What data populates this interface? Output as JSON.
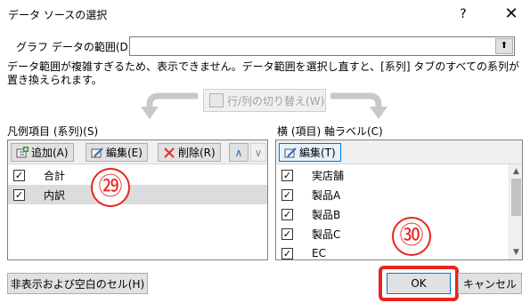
{
  "dialog": {
    "title": "データ ソースの選択",
    "help_label": "?",
    "close_label": "✕"
  },
  "range": {
    "label": "グラフ データの範囲(D):",
    "value": "",
    "button_glyph": "⬆"
  },
  "info_text": "データ範囲が複雑すぎるため、表示できません。データ範囲を選択し直すと、[系列] タブのすべての系列が置き換えられます。",
  "switch_button": {
    "label": "行/列の切り替え(W)"
  },
  "legend": {
    "title": "凡例項目 (系列)(S)",
    "add_label": "追加(A)",
    "edit_label": "編集(E)",
    "delete_label": "削除(R)",
    "up_glyph": "∧",
    "down_glyph": "∨",
    "items": [
      {
        "label": "合計",
        "checked": "✓"
      },
      {
        "label": "内訳",
        "checked": "✓"
      }
    ]
  },
  "axis": {
    "title": "横 (項目) 軸ラベル(C)",
    "edit_label": "編集(T)",
    "items": [
      {
        "label": "実店舗",
        "checked": "✓"
      },
      {
        "label": "製品A",
        "checked": "✓"
      },
      {
        "label": "製品B",
        "checked": "✓"
      },
      {
        "label": "製品C",
        "checked": "✓"
      },
      {
        "label": "EC",
        "checked": "✓"
      }
    ]
  },
  "annotations": {
    "badge_29": "㉙",
    "badge_30": "㉚"
  },
  "footer": {
    "hidden_cells_label": "非表示および空白のセル(H)",
    "ok_label": "OK",
    "cancel_label": "キャンセル"
  },
  "colors": {
    "accent": "#0078d7",
    "annotation_red": "#e8251f"
  }
}
